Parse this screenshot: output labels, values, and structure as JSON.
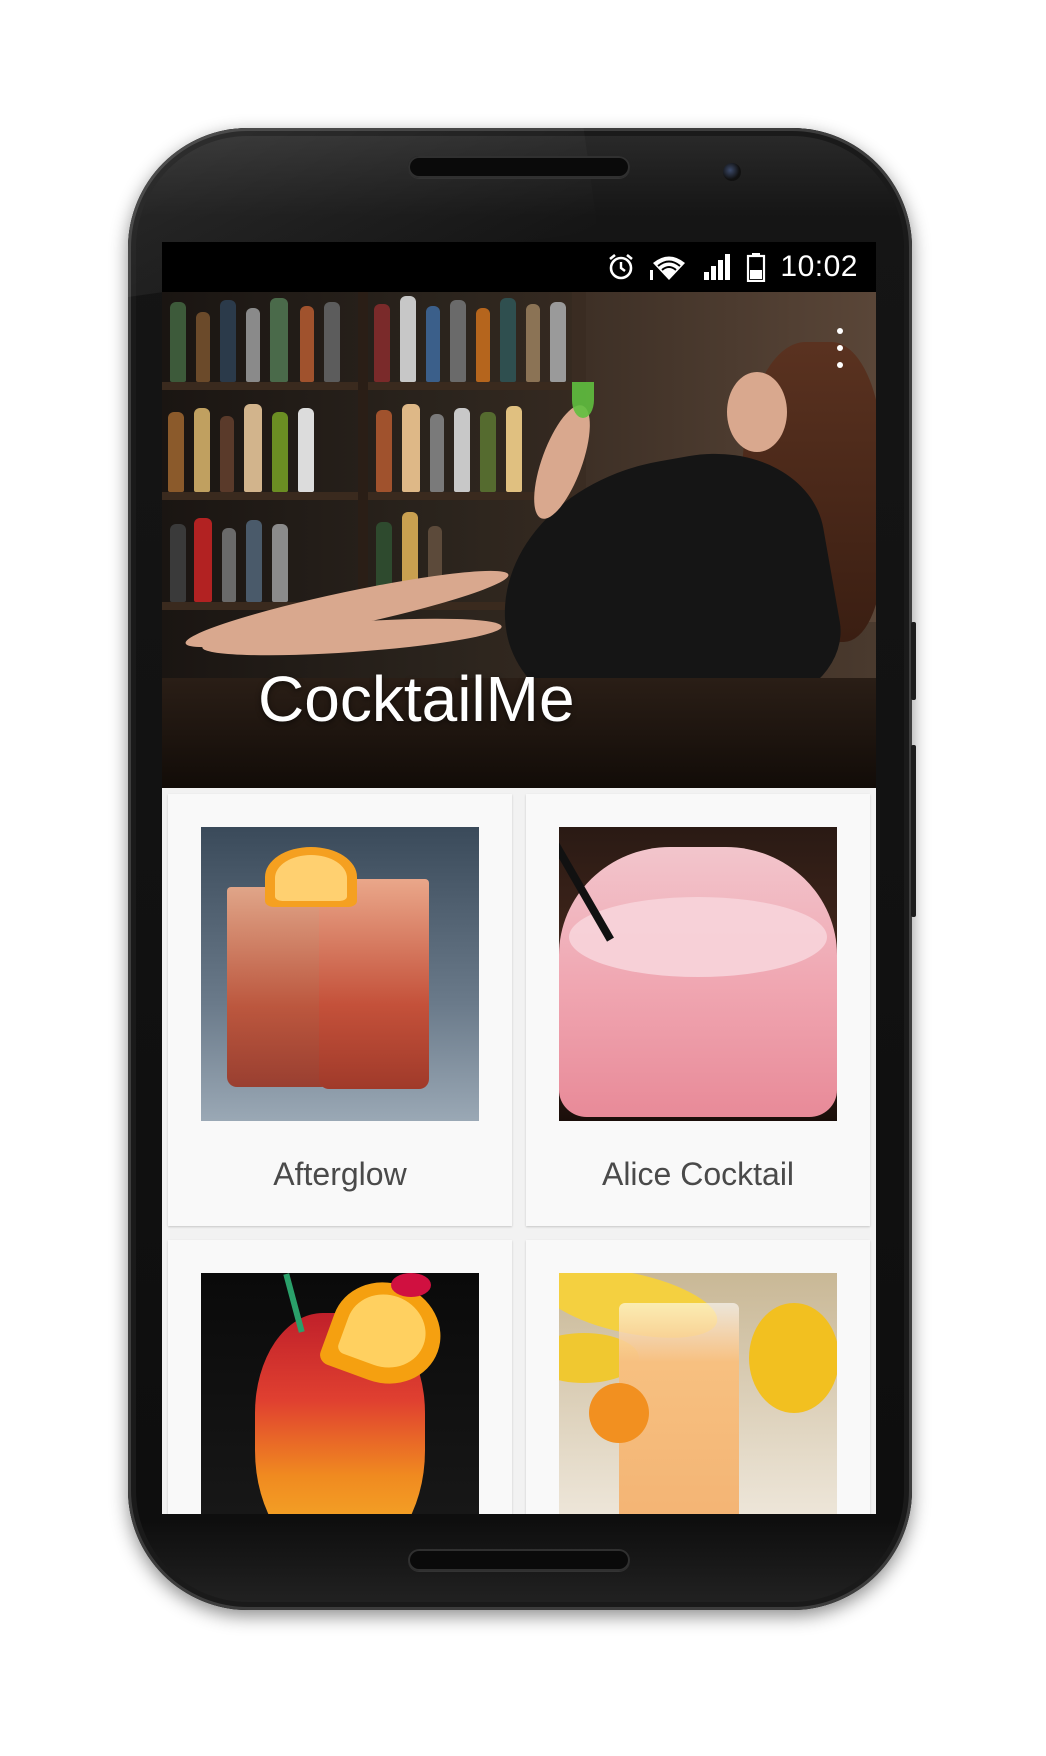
{
  "status_bar": {
    "time": "10:02",
    "icons": [
      "alarm-icon",
      "wifi-icon",
      "signal-icon",
      "battery-icon"
    ]
  },
  "app_bar": {
    "title": "CocktailMe",
    "menu_icon": "overflow-menu-icon"
  },
  "cocktails": [
    {
      "name": "Afterglow"
    },
    {
      "name": "Alice Cocktail"
    },
    {
      "name": ""
    },
    {
      "name": ""
    }
  ],
  "colors": {
    "card_background": "#f9f9f9",
    "screen_background": "#f2f2f2",
    "label_text": "#4a4a4a"
  }
}
